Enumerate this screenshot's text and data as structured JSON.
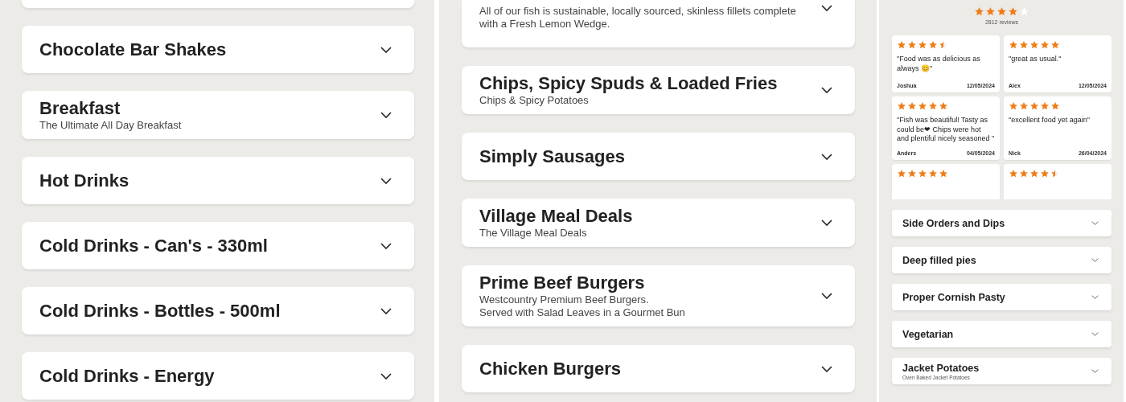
{
  "left_panel": {
    "categories": [
      {
        "title": "Chocolate Bar Shakes"
      },
      {
        "title": "Breakfast",
        "subtitle": "The Ultimate All Day Breakfast"
      },
      {
        "title": "Hot Drinks"
      },
      {
        "title": "Cold Drinks - Can's - 330ml"
      },
      {
        "title": "Cold Drinks - Bottles - 500ml"
      },
      {
        "title": "Cold Drinks - Energy"
      }
    ]
  },
  "middle_panel": {
    "categories": [
      {
        "subtitle": "All of our fish is sustainable, locally sourced, skinless fillets complete with a Fresh Lemon Wedge."
      },
      {
        "title": "Chips, Spicy Spuds & Loaded Fries",
        "subtitle": "Chips & Spicy Potatoes"
      },
      {
        "title": "Simply Sausages"
      },
      {
        "title": "Village Meal Deals",
        "subtitle": "The Village Meal Deals"
      },
      {
        "title": "Prime Beef Burgers",
        "subtitle": "Westcountry Premium Beef Burgers.\nServed with Salad Leaves in a Gourmet Bun"
      },
      {
        "title": "Chicken Burgers"
      }
    ]
  },
  "right_panel": {
    "rating": {
      "stars": 4,
      "count": "2812 reviews"
    },
    "reviews": [
      {
        "stars": 4.5,
        "text": "\"Food was as delicious as always 😊\"",
        "author": "Joshua",
        "date": "12/05/2024"
      },
      {
        "stars": 5,
        "text": "\"great as usual.\"",
        "author": "Alex",
        "date": "12/05/2024"
      },
      {
        "stars": 5,
        "text": "\"Fish was beautiful! Tasty as could be❤ Chips were hot and plentiful nicely seasoned \"",
        "author": "Anders",
        "date": "04/05/2024"
      },
      {
        "stars": 5,
        "text": "\"excellent food yet again\"",
        "author": "Nick",
        "date": "26/04/2024"
      },
      {
        "stars": 5
      },
      {
        "stars": 4.5
      }
    ],
    "categories": [
      {
        "title": "Side Orders and Dips"
      },
      {
        "title": "Deep filled pies"
      },
      {
        "title": "Proper Cornish Pasty"
      },
      {
        "title": "Vegetarian"
      },
      {
        "title": "Jacket Potatoes",
        "subtitle": "Oven Baked Jacket Potatoes"
      }
    ]
  }
}
